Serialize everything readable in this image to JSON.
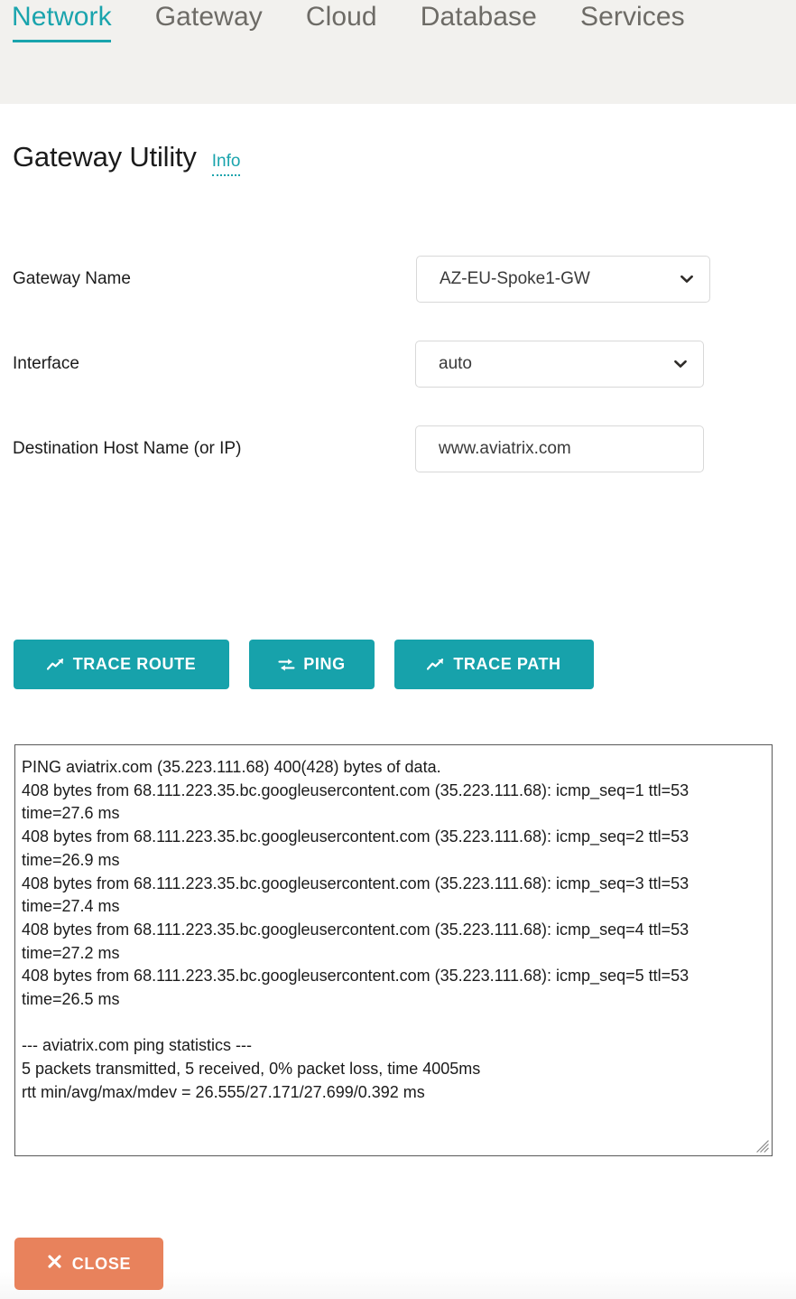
{
  "tabbar": {
    "tabs": [
      {
        "label": "Network",
        "active": true
      },
      {
        "label": "Gateway",
        "active": false
      },
      {
        "label": "Cloud",
        "active": false
      },
      {
        "label": "Database",
        "active": false
      },
      {
        "label": "Services",
        "active": false
      }
    ]
  },
  "page": {
    "title": "Gateway Utility",
    "info_label": "Info"
  },
  "form": {
    "gateway_name": {
      "label": "Gateway Name",
      "value": "AZ-EU-Spoke1-GW",
      "icon": "chevron-down-icon"
    },
    "interface": {
      "label": "Interface",
      "value": "auto",
      "icon": "chevron-down-icon"
    },
    "destination": {
      "label": "Destination Host Name (or IP)",
      "value": "www.aviatrix.com",
      "placeholder": "www.aviatrix.com"
    }
  },
  "actions": {
    "trace_route": {
      "label": "TRACE ROUTE",
      "icon": "chart-line-icon"
    },
    "ping": {
      "label": "PING",
      "icon": "exchange-arrows-icon"
    },
    "trace_path": {
      "label": "TRACE PATH",
      "icon": "chart-line-icon"
    }
  },
  "output": {
    "text": "PING aviatrix.com (35.223.111.68) 400(428) bytes of data.\n408 bytes from 68.111.223.35.bc.googleusercontent.com (35.223.111.68): icmp_seq=1 ttl=53 time=27.6 ms\n408 bytes from 68.111.223.35.bc.googleusercontent.com (35.223.111.68): icmp_seq=2 ttl=53 time=26.9 ms\n408 bytes from 68.111.223.35.bc.googleusercontent.com (35.223.111.68): icmp_seq=3 ttl=53 time=27.4 ms\n408 bytes from 68.111.223.35.bc.googleusercontent.com (35.223.111.68): icmp_seq=4 ttl=53 time=27.2 ms\n408 bytes from 68.111.223.35.bc.googleusercontent.com (35.223.111.68): icmp_seq=5 ttl=53 time=26.5 ms\n\n--- aviatrix.com ping statistics ---\n5 packets transmitted, 5 received, 0% packet loss, time 4005ms\nrtt min/avg/max/mdev = 26.555/27.171/27.699/0.392 ms"
  },
  "footer": {
    "close": {
      "label": "CLOSE",
      "icon": "close-x-icon"
    }
  },
  "colors": {
    "accent_teal": "#17a2ab",
    "header_bg": "#f2f1ee",
    "close_orange": "#e8825c",
    "tab_inactive": "#6d6b66",
    "text": "#1b1b1b"
  }
}
